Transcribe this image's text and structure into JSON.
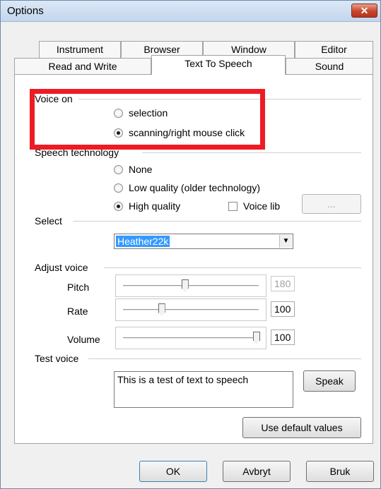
{
  "window": {
    "title": "Options",
    "close_symbol": "✕"
  },
  "tabs": {
    "row1": [
      "Instrument",
      "Browser",
      "Window",
      "Editor"
    ],
    "row2": [
      "Read and Write",
      "Text To Speech",
      "Sound"
    ],
    "active": "Text To Speech"
  },
  "voice_on": {
    "label": "Voice on",
    "options": [
      {
        "label": "selection",
        "checked": false
      },
      {
        "label": "scanning/right mouse click",
        "checked": true
      }
    ]
  },
  "speech_technology": {
    "label": "Speech technology",
    "options": [
      {
        "label": "None",
        "checked": false
      },
      {
        "label": "Low quality (older technology)",
        "checked": false
      },
      {
        "label": "High quality",
        "checked": true
      }
    ],
    "voice_lib": {
      "label": "Voice lib",
      "checked": false
    },
    "browse_label": "..."
  },
  "select": {
    "label": "Select",
    "value": "Heather22k",
    "arrow": "▼"
  },
  "adjust_voice": {
    "label": "Adjust voice",
    "pitch": {
      "label": "Pitch",
      "value": "180",
      "level": 0.45,
      "disabled": true
    },
    "rate": {
      "label": "Rate",
      "value": "100",
      "level": 0.27,
      "disabled": false
    },
    "volume": {
      "label": "Volume",
      "value": "100",
      "level": 1.0,
      "disabled": false
    }
  },
  "test_voice": {
    "label": "Test voice",
    "text": "This is a test of text to speech",
    "speak_label": "Speak"
  },
  "defaults_label": "Use default values",
  "footer": {
    "ok": "OK",
    "cancel": "Avbryt",
    "apply": "Bruk"
  },
  "colors": {
    "highlight": "#ee1b24",
    "selection": "#3399ff"
  }
}
